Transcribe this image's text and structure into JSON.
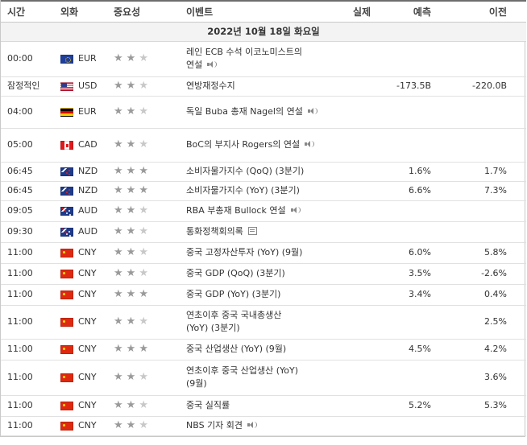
{
  "headers": {
    "time": "시간",
    "currency": "외화",
    "importance": "중요성",
    "event": "이벤트",
    "actual": "실제",
    "forecast": "예측",
    "previous": "이전"
  },
  "date": "2022년 10월 18일 화요일",
  "rows": [
    {
      "time": "00:00",
      "currency": "EUR",
      "flag": "eu",
      "stars": 2,
      "event_line1": "레인 ECB 수석 이코노미스트의",
      "event_line2": "연설",
      "icon": "speaker-icon",
      "actual": "",
      "forecast": "",
      "previous": ""
    },
    {
      "time": "잠정적인",
      "currency": "USD",
      "flag": "us",
      "stars": 2,
      "event_line1": "연방재정수지",
      "event_line2": "",
      "icon": "",
      "actual": "",
      "forecast": "-173.5B",
      "previous": "-220.0B"
    },
    {
      "time": "04:00",
      "currency": "EUR",
      "flag": "de",
      "stars": 2,
      "event_line1": "독일 Buba 총재 Nagel의 연설",
      "event_line2": "",
      "icon": "speaker-icon",
      "actual": "",
      "forecast": "",
      "previous": ""
    },
    {
      "time": "05:00",
      "currency": "CAD",
      "flag": "ca",
      "stars": 2,
      "event_line1": "BoC의 부지사 Rogers의 연설",
      "event_line2": "",
      "icon": "speaker-icon",
      "actual": "",
      "forecast": "",
      "previous": ""
    },
    {
      "time": "06:45",
      "currency": "NZD",
      "flag": "nz",
      "stars": 3,
      "event_line1": "소비자물가지수 (QoQ) (3분기)",
      "event_line2": "",
      "icon": "",
      "actual": "",
      "forecast": "1.6%",
      "previous": "1.7%"
    },
    {
      "time": "06:45",
      "currency": "NZD",
      "flag": "nz",
      "stars": 3,
      "event_line1": "소비자물가지수 (YoY) (3분기)",
      "event_line2": "",
      "icon": "",
      "actual": "",
      "forecast": "6.6%",
      "previous": "7.3%"
    },
    {
      "time": "09:05",
      "currency": "AUD",
      "flag": "au",
      "stars": 2,
      "event_line1": "RBA 부총재 Bullock 연설",
      "event_line2": "",
      "icon": "speaker-icon",
      "actual": "",
      "forecast": "",
      "previous": ""
    },
    {
      "time": "09:30",
      "currency": "AUD",
      "flag": "au",
      "stars": 2,
      "event_line1": "통화정책회의록",
      "event_line2": "",
      "icon": "document-icon",
      "actual": "",
      "forecast": "",
      "previous": ""
    },
    {
      "time": "11:00",
      "currency": "CNY",
      "flag": "cn",
      "stars": 2,
      "event_line1": "중국 고정자산투자 (YoY) (9월)",
      "event_line2": "",
      "icon": "",
      "actual": "",
      "forecast": "6.0%",
      "previous": "5.8%"
    },
    {
      "time": "11:00",
      "currency": "CNY",
      "flag": "cn",
      "stars": 2,
      "event_line1": "중국 GDP (QoQ) (3분기)",
      "event_line2": "",
      "icon": "",
      "actual": "",
      "forecast": "3.5%",
      "previous": "-2.6%"
    },
    {
      "time": "11:00",
      "currency": "CNY",
      "flag": "cn",
      "stars": 3,
      "event_line1": "중국 GDP (YoY) (3분기)",
      "event_line2": "",
      "icon": "",
      "actual": "",
      "forecast": "3.4%",
      "previous": "0.4%"
    },
    {
      "time": "11:00",
      "currency": "CNY",
      "flag": "cn",
      "stars": 2,
      "event_line1": "연초이후 중국 국내총생산",
      "event_line2": "(YoY) (3분기)",
      "icon": "",
      "actual": "",
      "forecast": "",
      "previous": "2.5%"
    },
    {
      "time": "11:00",
      "currency": "CNY",
      "flag": "cn",
      "stars": 3,
      "event_line1": "중국 산업생산 (YoY) (9월)",
      "event_line2": "",
      "icon": "",
      "actual": "",
      "forecast": "4.5%",
      "previous": "4.2%"
    },
    {
      "time": "11:00",
      "currency": "CNY",
      "flag": "cn",
      "stars": 2,
      "event_line1": "연초이후 중국 산업생산 (YoY)",
      "event_line2": "(9월)",
      "icon": "",
      "actual": "",
      "forecast": "",
      "previous": "3.6%"
    },
    {
      "time": "11:00",
      "currency": "CNY",
      "flag": "cn",
      "stars": 2,
      "event_line1": "중국 실직률",
      "event_line2": "",
      "icon": "",
      "actual": "",
      "forecast": "5.2%",
      "previous": "5.3%"
    },
    {
      "time": "11:00",
      "currency": "CNY",
      "flag": "cn",
      "stars": 2,
      "event_line1": "NBS 기자 회견",
      "event_line2": "",
      "icon": "speaker-icon",
      "actual": "",
      "forecast": "",
      "previous": ""
    }
  ]
}
